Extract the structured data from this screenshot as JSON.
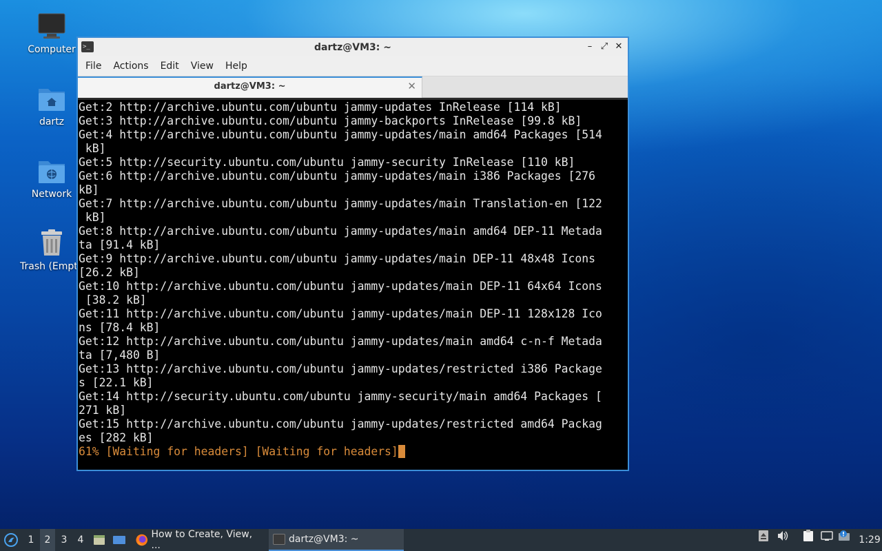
{
  "desktop": {
    "icons": [
      {
        "label": "Computer"
      },
      {
        "label": "dartz"
      },
      {
        "label": "Network"
      },
      {
        "label": "Trash (Empty)"
      }
    ]
  },
  "window": {
    "title": "dartz@VM3: ~",
    "controls": {
      "minimize": "–",
      "maximize": "⤢",
      "close": "✕"
    },
    "menu": [
      "File",
      "Actions",
      "Edit",
      "View",
      "Help"
    ],
    "tab": {
      "title": "dartz@VM3: ~",
      "close": "✕"
    }
  },
  "terminal": {
    "lines": [
      "Get:2 http://archive.ubuntu.com/ubuntu jammy-updates InRelease [114 kB]",
      "Get:3 http://archive.ubuntu.com/ubuntu jammy-backports InRelease [99.8 kB]",
      "Get:4 http://archive.ubuntu.com/ubuntu jammy-updates/main amd64 Packages [514",
      " kB]",
      "Get:5 http://security.ubuntu.com/ubuntu jammy-security InRelease [110 kB]",
      "Get:6 http://archive.ubuntu.com/ubuntu jammy-updates/main i386 Packages [276",
      "kB]",
      "Get:7 http://archive.ubuntu.com/ubuntu jammy-updates/main Translation-en [122",
      " kB]",
      "Get:8 http://archive.ubuntu.com/ubuntu jammy-updates/main amd64 DEP-11 Metada",
      "ta [91.4 kB]",
      "Get:9 http://archive.ubuntu.com/ubuntu jammy-updates/main DEP-11 48x48 Icons",
      "[26.2 kB]",
      "Get:10 http://archive.ubuntu.com/ubuntu jammy-updates/main DEP-11 64x64 Icons",
      " [38.2 kB]",
      "Get:11 http://archive.ubuntu.com/ubuntu jammy-updates/main DEP-11 128x128 Ico",
      "ns [78.4 kB]",
      "Get:12 http://archive.ubuntu.com/ubuntu jammy-updates/main amd64 c-n-f Metada",
      "ta [7,480 B]",
      "Get:13 http://archive.ubuntu.com/ubuntu jammy-updates/restricted i386 Package",
      "s [22.1 kB]",
      "Get:14 http://security.ubuntu.com/ubuntu jammy-security/main amd64 Packages [",
      "271 kB]",
      "Get:15 http://archive.ubuntu.com/ubuntu jammy-updates/restricted amd64 Packag",
      "es [282 kB]"
    ],
    "progress_line": "61% [Waiting for headers] [Waiting for headers]"
  },
  "taskbar": {
    "workspaces": [
      "1",
      "2",
      "3",
      "4"
    ],
    "active_workspace": "2",
    "tasks": [
      {
        "label": "How to Create, View, ..."
      },
      {
        "label": "dartz@VM3: ~"
      }
    ],
    "clock": "1:29"
  },
  "colors": {
    "accent": "#3b8ed8",
    "terminal_bg": "#000000",
    "terminal_fg": "#e6e6e6",
    "progress": "#d98b3a",
    "taskbar": "#27313a"
  }
}
